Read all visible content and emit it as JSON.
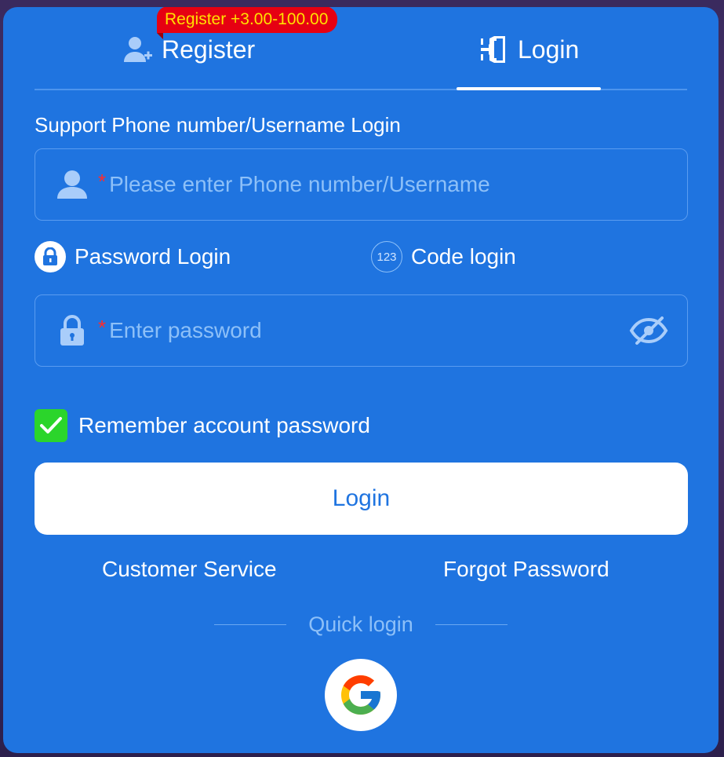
{
  "tabs": {
    "register_label": "Register",
    "login_label": "Login",
    "active": "login",
    "register_badge": "Register +3.00-100.00"
  },
  "form": {
    "support_label": "Support Phone number/Username Login",
    "username": {
      "required_mark": "*",
      "placeholder": "Please enter Phone number/Username",
      "value": ""
    },
    "modes": {
      "password_label": "Password Login",
      "code_label": "Code login",
      "code_icon_text": "123"
    },
    "password": {
      "required_mark": "*",
      "placeholder": "Enter password",
      "value": ""
    },
    "remember": {
      "label": "Remember account password",
      "checked": true
    },
    "submit_label": "Login"
  },
  "links": {
    "customer_service": "Customer Service",
    "forgot_password": "Forgot Password"
  },
  "quick_login": {
    "label": "Quick login",
    "providers": [
      "google"
    ]
  },
  "icons": {
    "register_tab": "user-plus-icon",
    "login_tab": "door-enter-icon",
    "username_field": "user-icon",
    "password_field": "lock-icon",
    "password_mode": "lock-icon",
    "code_mode": "123-icon",
    "toggle_visibility": "eye-off-icon",
    "remember": "checkmark-icon",
    "google": "google-icon"
  },
  "colors": {
    "panel": "#1f74e0",
    "badge_bg": "#e60012",
    "badge_text": "#ffe100",
    "checkbox": "#2bd52b",
    "placeholder": "#8dc0f8",
    "required": "#ff2b2b"
  }
}
